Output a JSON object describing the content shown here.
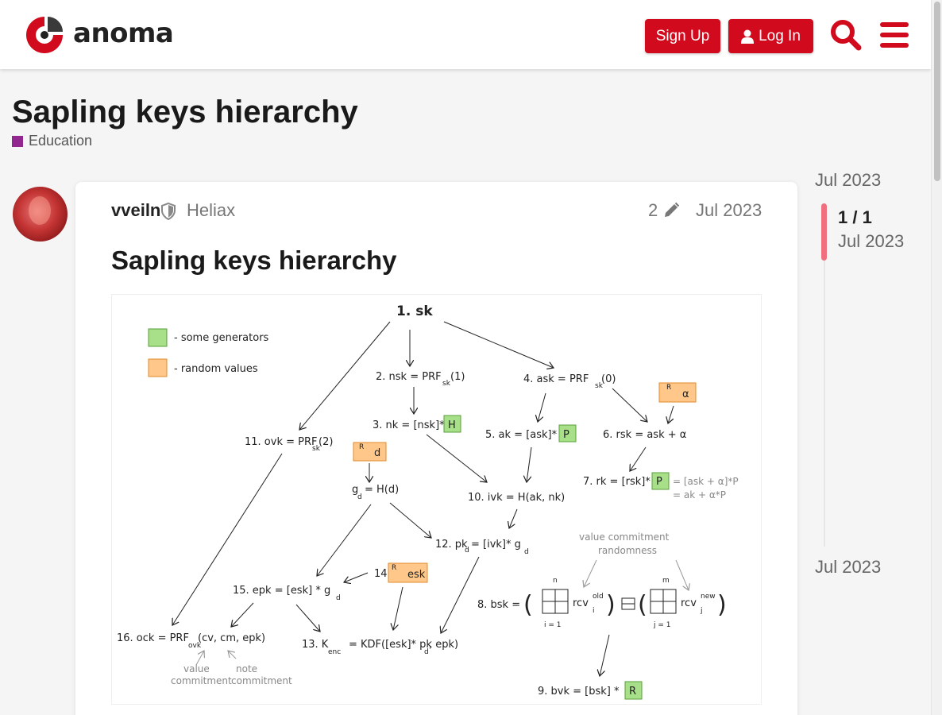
{
  "header": {
    "logo_text": "anoma",
    "signup_label": "Sign Up",
    "login_label": "Log In"
  },
  "topic": {
    "title": "Sapling keys hierarchy",
    "category": "Education",
    "category_color": "#92278f"
  },
  "post": {
    "username": "vveiln",
    "group": "Heliax",
    "edit_count": "2",
    "date": "Jul 2023",
    "heading": "Sapling keys hierarchy"
  },
  "timeline": {
    "start_date": "Jul 2023",
    "position": "1 / 1",
    "position_date": "Jul 2023",
    "end_date": "Jul 2023"
  },
  "diagram": {
    "legend": {
      "generators": "- some generators",
      "random": "- random values"
    },
    "nodes": {
      "sk": "1. sk",
      "nsk": "2. nsk = PRF",
      "nsk_sub": "sk",
      "nsk_arg": "(1)",
      "ask": "4. ask = PRF",
      "ask_sub": "sk",
      "ask_arg": "(0)",
      "nk": "3. nk = [nsk]*",
      "nk_gen": "H",
      "ak": "5. ak = [ask]*",
      "ak_gen": "P",
      "rsk": "6. rsk = ask + α",
      "rand_alpha": "α",
      "rk": "7. rk = [rsk]*",
      "rk_gen": "P",
      "rk_note1": "= [ask + α]*P",
      "rk_note2": "= ak + α*P",
      "ovk": "11. ovk = PRF",
      "ovk_sub": "sk",
      "ovk_arg": "(2)",
      "rand_d": "d",
      "gd": "g",
      "gd_sub": "d",
      "gd_eq": "= H(d)",
      "ivk": "10. ivk = H(ak, nk)",
      "pkd": "12. pk",
      "pkd_sub": "d",
      "pkd_eq": "= [ivk]* g",
      "pkd_eq_sub": "d",
      "vcr1": "value commitment",
      "vcr2": "randomness",
      "esk": "esk",
      "esk_num": "14.",
      "epk": "15. epk = [esk] * g",
      "epk_sub": "d",
      "bsk": "8. bsk =",
      "bsk_n": "n",
      "bsk_m": "m",
      "bsk_rcv1": "rcv",
      "bsk_old": "old",
      "bsk_i": "i",
      "bsk_rcv2": "rcv",
      "bsk_new": "new",
      "bsk_j": "j",
      "bsk_i1": "i = 1",
      "bsk_j1": "j = 1",
      "ock": "16. ock = PRF",
      "ock_sub": "ovk",
      "ock_arg": "(cv, cm, epk)",
      "kenc": "13. K",
      "kenc_sub": "enc",
      "kenc_eq": "= KDF([esk]* pk",
      "kenc_eq_sub": "d",
      "kenc_tail": ", epk)",
      "vc1": "value",
      "vc2": "commitment",
      "nc1": "note",
      "nc2": "commitment",
      "bvk": "9. bvk = [bsk] *",
      "bvk_gen": "R",
      "rand_arrow": "R"
    }
  }
}
